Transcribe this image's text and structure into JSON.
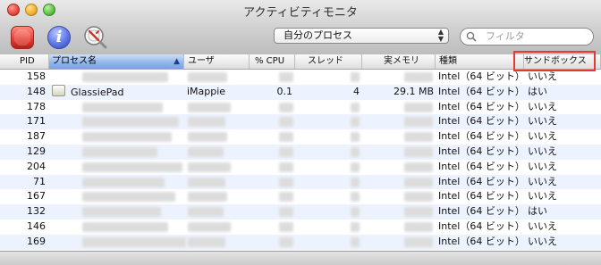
{
  "window": {
    "title": "アクティビティモニタ"
  },
  "toolbar": {
    "info_glyph": "i",
    "process_filter_value": "自分のプロセス",
    "search_placeholder": "フィルタ"
  },
  "table": {
    "columns": {
      "pid": "PID",
      "name": "プロセス名",
      "user": "ユーザ",
      "cpu": "% CPU",
      "threads": "スレッド",
      "memory": "実メモリ",
      "kind": "種類",
      "sandbox": "サンドボックス"
    },
    "sort_indicator": "▲",
    "rows": [
      {
        "pid": "158",
        "name": "",
        "user": "",
        "cpu": "",
        "threads": "",
        "memory": "",
        "kind": "Intel（64 ビット）",
        "sandbox": "いいえ"
      },
      {
        "pid": "148",
        "name": "GlassiePad",
        "user": "iMappie",
        "cpu": "0.1",
        "threads": "4",
        "memory": "29.1 MB",
        "kind": "Intel（64 ビット）",
        "sandbox": "はい"
      },
      {
        "pid": "178",
        "name": "",
        "user": "",
        "cpu": "",
        "threads": "",
        "memory": "",
        "kind": "Intel（64 ビット）",
        "sandbox": "いいえ"
      },
      {
        "pid": "171",
        "name": "",
        "user": "",
        "cpu": "",
        "threads": "",
        "memory": "",
        "kind": "Intel（64 ビット）",
        "sandbox": "いいえ"
      },
      {
        "pid": "187",
        "name": "",
        "user": "",
        "cpu": "",
        "threads": "",
        "memory": "",
        "kind": "Intel（64 ビット）",
        "sandbox": "いいえ"
      },
      {
        "pid": "129",
        "name": "",
        "user": "",
        "cpu": "",
        "threads": "",
        "memory": "",
        "kind": "Intel（64 ビット）",
        "sandbox": "いいえ"
      },
      {
        "pid": "204",
        "name": "",
        "user": "",
        "cpu": "",
        "threads": "",
        "memory": "",
        "kind": "Intel（64 ビット）",
        "sandbox": "いいえ"
      },
      {
        "pid": "71",
        "name": "",
        "user": "",
        "cpu": "",
        "threads": "",
        "memory": "",
        "kind": "Intel（64 ビット）",
        "sandbox": "いいえ"
      },
      {
        "pid": "167",
        "name": "",
        "user": "",
        "cpu": "",
        "threads": "",
        "memory": "",
        "kind": "Intel（64 ビット）",
        "sandbox": "いいえ"
      },
      {
        "pid": "132",
        "name": "",
        "user": "",
        "cpu": "",
        "threads": "",
        "memory": "",
        "kind": "Intel（64 ビット）",
        "sandbox": "はい"
      },
      {
        "pid": "146",
        "name": "",
        "user": "",
        "cpu": "",
        "threads": "",
        "memory": "",
        "kind": "Intel（64 ビット）",
        "sandbox": "いいえ"
      },
      {
        "pid": "169",
        "name": "",
        "user": "",
        "cpu": "",
        "threads": "",
        "memory": "",
        "kind": "Intel（64 ビット）",
        "sandbox": "いいえ"
      }
    ]
  },
  "colors": {
    "highlight_border": "#e8392f",
    "sorted_header": "#93b6ea",
    "alt_row": "#edf3fe"
  },
  "icons": {
    "stop": "stop-process-icon",
    "info": "info-icon",
    "inspect": "inspect-icon",
    "search": "magnifier-icon",
    "app": "app-icon"
  }
}
